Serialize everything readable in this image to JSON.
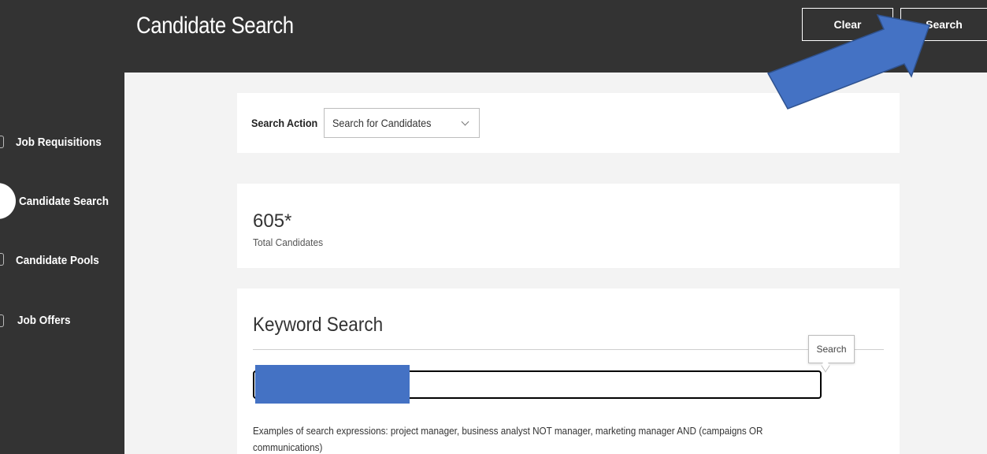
{
  "header": {
    "title": "Candidate Search",
    "clear_label": "Clear",
    "search_label": "Search"
  },
  "sidebar": {
    "items": [
      {
        "label": "Job Requisitions",
        "active": false
      },
      {
        "label": "Candidate Search",
        "active": true
      },
      {
        "label": "Candidate Pools",
        "active": false
      },
      {
        "label": "Job Offers",
        "active": false
      }
    ]
  },
  "search_action": {
    "label": "Search Action",
    "selected": "Search for Candidates"
  },
  "totals": {
    "value": "605*",
    "label": "Total Candidates"
  },
  "keyword_search": {
    "title": "Keyword Search",
    "input_value": "",
    "tooltip": "Search",
    "help_text": "Examples of search expressions: project manager, business analyst NOT manager, marketing manager AND (campaigns OR communications)"
  },
  "annotations": {
    "arrow_color": "#4472c4",
    "redaction_color": "#4472c4"
  }
}
